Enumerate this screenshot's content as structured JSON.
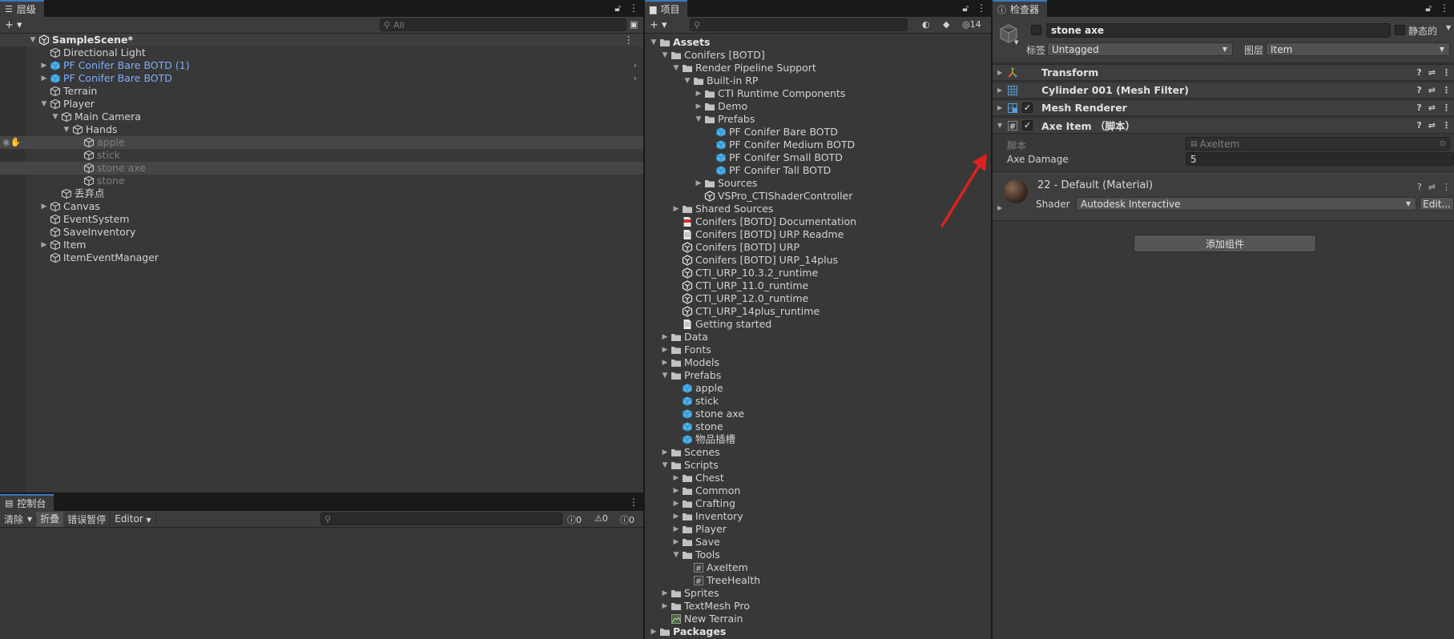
{
  "hierarchy": {
    "tab_title": "层级",
    "search_placeholder": "All",
    "add_label": "+ ▾",
    "rows": [
      {
        "label": "SampleScene*",
        "depth": 0,
        "arrow": "open",
        "icon": "unity",
        "bold": true,
        "style": "scene"
      },
      {
        "label": "Directional Light",
        "depth": 1,
        "arrow": "",
        "icon": "cube",
        "style": ""
      },
      {
        "label": "PF Conifer Bare BOTD (1)",
        "depth": 1,
        "arrow": "closed",
        "icon": "prefab",
        "style": "blue",
        "more": true
      },
      {
        "label": "PF Conifer Bare BOTD",
        "depth": 1,
        "arrow": "closed",
        "icon": "prefab",
        "style": "blue",
        "more": true
      },
      {
        "label": "Terrain",
        "depth": 1,
        "arrow": "",
        "icon": "cube",
        "style": ""
      },
      {
        "label": "Player",
        "depth": 1,
        "arrow": "open",
        "icon": "cube",
        "style": ""
      },
      {
        "label": "Main Camera",
        "depth": 2,
        "arrow": "open",
        "icon": "cube",
        "style": ""
      },
      {
        "label": "Hands",
        "depth": 3,
        "arrow": "open",
        "icon": "cube",
        "style": ""
      },
      {
        "label": "apple",
        "depth": 4,
        "arrow": "",
        "icon": "cube",
        "style": "dim",
        "hl": true,
        "eye": true
      },
      {
        "label": "stick",
        "depth": 4,
        "arrow": "",
        "icon": "cube",
        "style": "dim"
      },
      {
        "label": "stone axe",
        "depth": 4,
        "arrow": "",
        "icon": "cube",
        "style": "dim",
        "sel": true
      },
      {
        "label": "stone",
        "depth": 4,
        "arrow": "",
        "icon": "cube",
        "style": "dim"
      },
      {
        "label": "丢弃点",
        "depth": 2,
        "arrow": "",
        "icon": "cube",
        "style": ""
      },
      {
        "label": "Canvas",
        "depth": 1,
        "arrow": "closed",
        "icon": "cube",
        "style": ""
      },
      {
        "label": "EventSystem",
        "depth": 1,
        "arrow": "",
        "icon": "cube",
        "style": ""
      },
      {
        "label": "SaveInventory",
        "depth": 1,
        "arrow": "",
        "icon": "cube",
        "style": ""
      },
      {
        "label": "Item",
        "depth": 1,
        "arrow": "closed",
        "icon": "cube",
        "style": ""
      },
      {
        "label": "ItemEventManager",
        "depth": 1,
        "arrow": "",
        "icon": "cube",
        "style": ""
      }
    ]
  },
  "console": {
    "tab_title": "控制台",
    "clear": "清除",
    "collapse": "折叠",
    "error_pause": "错误暂停",
    "editor": "Editor",
    "count_info": "0",
    "count_warn": "0",
    "count_error": "0"
  },
  "project": {
    "tab_title": "项目",
    "add_label": "+ ▾",
    "hidden_count": "14",
    "rows": [
      {
        "label": "Assets",
        "depth": 0,
        "arrow": "open",
        "icon": "folder",
        "bold": true
      },
      {
        "label": "Conifers [BOTD]",
        "depth": 1,
        "arrow": "open",
        "icon": "folder"
      },
      {
        "label": "Render Pipeline Support",
        "depth": 2,
        "arrow": "open",
        "icon": "folder"
      },
      {
        "label": "Built-in RP",
        "depth": 3,
        "arrow": "open",
        "icon": "folder"
      },
      {
        "label": "CTI Runtime Components",
        "depth": 4,
        "arrow": "closed",
        "icon": "folder"
      },
      {
        "label": "Demo",
        "depth": 4,
        "arrow": "closed",
        "icon": "folder"
      },
      {
        "label": "Prefabs",
        "depth": 4,
        "arrow": "open",
        "icon": "folder"
      },
      {
        "label": "PF Conifer Bare BOTD",
        "depth": 5,
        "arrow": "",
        "icon": "prefab"
      },
      {
        "label": "PF Conifer Medium BOTD",
        "depth": 5,
        "arrow": "",
        "icon": "prefab"
      },
      {
        "label": "PF Conifer Small BOTD",
        "depth": 5,
        "arrow": "",
        "icon": "prefab"
      },
      {
        "label": "PF Conifer Tall BOTD",
        "depth": 5,
        "arrow": "",
        "icon": "prefab"
      },
      {
        "label": "Sources",
        "depth": 4,
        "arrow": "closed",
        "icon": "folder"
      },
      {
        "label": "VSPro_CTIShaderController",
        "depth": 4,
        "arrow": "",
        "icon": "unity"
      },
      {
        "label": "Shared Sources",
        "depth": 2,
        "arrow": "closed",
        "icon": "folder"
      },
      {
        "label": "Conifers [BOTD] Documentation",
        "depth": 2,
        "arrow": "",
        "icon": "pdf"
      },
      {
        "label": "Conifers [BOTD] URP Readme",
        "depth": 2,
        "arrow": "",
        "icon": "doc"
      },
      {
        "label": "Conifers [BOTD] URP",
        "depth": 2,
        "arrow": "",
        "icon": "unity"
      },
      {
        "label": "Conifers [BOTD] URP_14plus",
        "depth": 2,
        "arrow": "",
        "icon": "unity"
      },
      {
        "label": "CTI_URP_10.3.2_runtime",
        "depth": 2,
        "arrow": "",
        "icon": "unity"
      },
      {
        "label": "CTI_URP_11.0_runtime",
        "depth": 2,
        "arrow": "",
        "icon": "unity"
      },
      {
        "label": "CTI_URP_12.0_runtime",
        "depth": 2,
        "arrow": "",
        "icon": "unity"
      },
      {
        "label": "CTI_URP_14plus_runtime",
        "depth": 2,
        "arrow": "",
        "icon": "unity"
      },
      {
        "label": "Getting started",
        "depth": 2,
        "arrow": "",
        "icon": "doc"
      },
      {
        "label": "Data",
        "depth": 1,
        "arrow": "closed",
        "icon": "folder"
      },
      {
        "label": "Fonts",
        "depth": 1,
        "arrow": "closed",
        "icon": "folder"
      },
      {
        "label": "Models",
        "depth": 1,
        "arrow": "closed",
        "icon": "folder"
      },
      {
        "label": "Prefabs",
        "depth": 1,
        "arrow": "open",
        "icon": "folder"
      },
      {
        "label": "apple",
        "depth": 2,
        "arrow": "",
        "icon": "prefab"
      },
      {
        "label": "stick",
        "depth": 2,
        "arrow": "",
        "icon": "prefab"
      },
      {
        "label": "stone axe",
        "depth": 2,
        "arrow": "",
        "icon": "prefab"
      },
      {
        "label": "stone",
        "depth": 2,
        "arrow": "",
        "icon": "prefab"
      },
      {
        "label": "物品插槽",
        "depth": 2,
        "arrow": "",
        "icon": "prefab"
      },
      {
        "label": "Scenes",
        "depth": 1,
        "arrow": "closed",
        "icon": "folder"
      },
      {
        "label": "Scripts",
        "depth": 1,
        "arrow": "open",
        "icon": "folder"
      },
      {
        "label": "Chest",
        "depth": 2,
        "arrow": "closed",
        "icon": "folder"
      },
      {
        "label": "Common",
        "depth": 2,
        "arrow": "closed",
        "icon": "folder"
      },
      {
        "label": "Crafting",
        "depth": 2,
        "arrow": "closed",
        "icon": "folder"
      },
      {
        "label": "Inventory",
        "depth": 2,
        "arrow": "closed",
        "icon": "folder"
      },
      {
        "label": "Player",
        "depth": 2,
        "arrow": "closed",
        "icon": "folder"
      },
      {
        "label": "Save",
        "depth": 2,
        "arrow": "closed",
        "icon": "folder"
      },
      {
        "label": "Tools",
        "depth": 2,
        "arrow": "open",
        "icon": "folder"
      },
      {
        "label": "AxeItem",
        "depth": 3,
        "arrow": "",
        "icon": "script"
      },
      {
        "label": "TreeHealth",
        "depth": 3,
        "arrow": "",
        "icon": "script"
      },
      {
        "label": "Sprites",
        "depth": 1,
        "arrow": "closed",
        "icon": "folder"
      },
      {
        "label": "TextMesh Pro",
        "depth": 1,
        "arrow": "closed",
        "icon": "folder"
      },
      {
        "label": "New Terrain",
        "depth": 1,
        "arrow": "",
        "icon": "terrain"
      },
      {
        "label": "Packages",
        "depth": 0,
        "arrow": "closed",
        "icon": "folder",
        "bold": true
      }
    ]
  },
  "inspector": {
    "tab_title": "检查器",
    "object_name": "stone axe",
    "static_label": "静态的",
    "tag_label": "标签",
    "tag_value": "Untagged",
    "layer_label": "图层",
    "layer_value": "Item",
    "components": [
      {
        "name": "Transform",
        "icon": "transform",
        "checkbox": false
      },
      {
        "name": "Cylinder 001 (Mesh Filter)",
        "icon": "meshfilter",
        "checkbox": false
      },
      {
        "name": "Mesh Renderer",
        "icon": "meshrenderer",
        "checkbox": true
      },
      {
        "name": "Axe Item （脚本）",
        "icon": "script",
        "checkbox": true,
        "open": true
      }
    ],
    "script_label": "脚本",
    "script_value": "AxeItem",
    "axe_damage_label": "Axe Damage",
    "axe_damage_value": "5",
    "material_title": "22 - Default (Material)",
    "shader_label": "Shader",
    "shader_value": "Autodesk Interactive",
    "edit_label": "Edit...",
    "add_component": "添加组件"
  },
  "colors": {
    "accent_tab": "#3a79bb",
    "prefab_blue": "#7cb0ff",
    "annotation_arrow": "#e02020"
  }
}
